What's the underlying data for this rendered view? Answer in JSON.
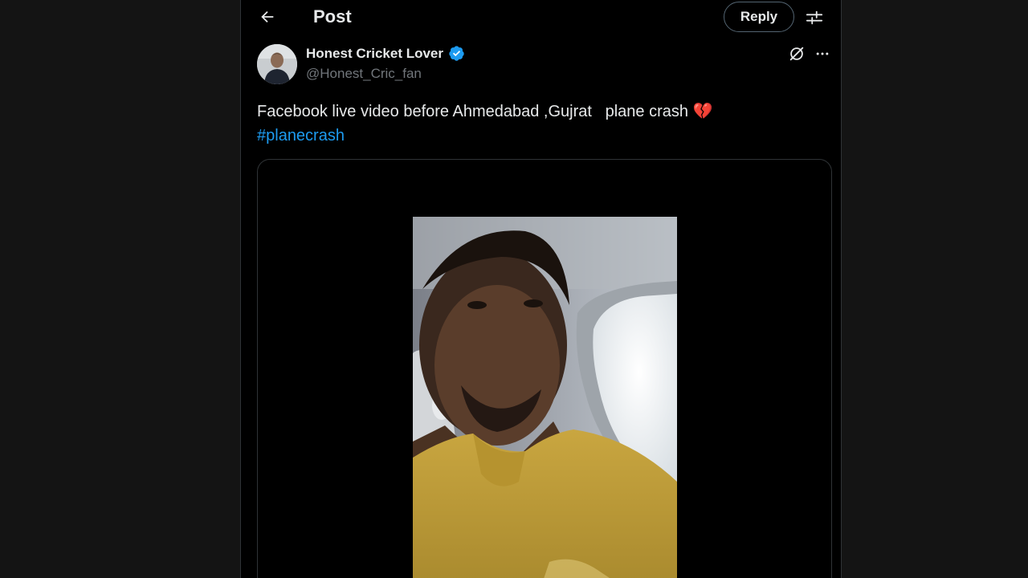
{
  "header": {
    "title": "Post",
    "back_icon": "arrow-left-icon",
    "reply_label": "Reply",
    "settings_icon": "sliders-icon"
  },
  "post": {
    "author": {
      "name": "Honest Cricket Lover",
      "handle": "@Honest_Cric_fan",
      "verified": true,
      "verified_color": "#1d9bf0",
      "avatar_icon": "user-avatar"
    },
    "text_main": "Facebook live video before Ahmedabad ,Gujrat   plane crash",
    "emoji": "💔",
    "hashtag": "#planecrash",
    "grok_icon": "grok-icon",
    "more_icon": "more-horizontal-icon",
    "media": {
      "type": "video",
      "description_icon": "video-thumbnail"
    }
  },
  "colors": {
    "accent": "#1d9bf0",
    "background": "#000000",
    "text": "#e7e9ea",
    "secondary_text": "#71767b"
  }
}
